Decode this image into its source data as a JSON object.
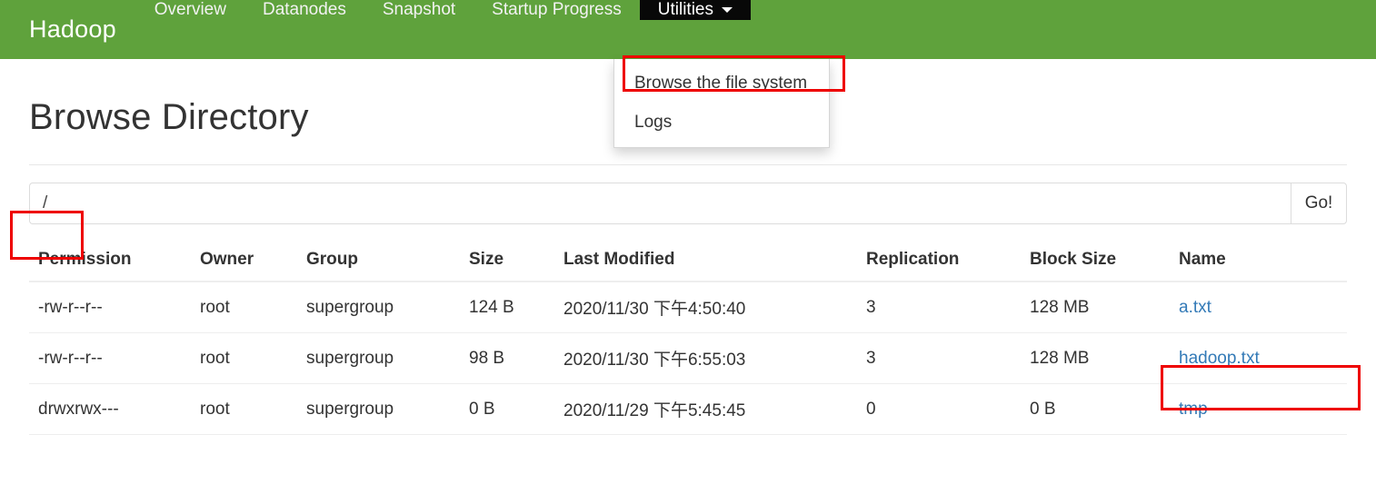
{
  "navbar": {
    "brand": "Hadoop",
    "background_color": "#5FA23C",
    "active_background_color": "#080808",
    "items": [
      {
        "label": "Overview",
        "name": "overview",
        "active": false,
        "caret": false
      },
      {
        "label": "Datanodes",
        "name": "datanodes",
        "active": false,
        "caret": false
      },
      {
        "label": "Snapshot",
        "name": "snapshot",
        "active": false,
        "caret": false
      },
      {
        "label": "Startup Progress",
        "name": "startup-progress",
        "active": false,
        "caret": false
      },
      {
        "label": "Utilities",
        "name": "utilities",
        "active": true,
        "caret": true
      }
    ]
  },
  "dropdown": {
    "open": true,
    "items": [
      {
        "label": "Browse the file system",
        "name": "browse-the-file-system",
        "highlighted": true
      },
      {
        "label": "Logs",
        "name": "logs",
        "highlighted": false
      }
    ]
  },
  "main": {
    "title": "Browse Directory"
  },
  "path_bar": {
    "value": "/",
    "placeholder": "",
    "go_label": "Go!",
    "highlighted": true
  },
  "table": {
    "columns": [
      "Permission",
      "Owner",
      "Group",
      "Size",
      "Last Modified",
      "Replication",
      "Block Size",
      "Name"
    ],
    "rows": [
      {
        "permission": "-rw-r--r--",
        "owner": "root",
        "group": "supergroup",
        "size": "124 B",
        "last_modified": "2020/11/30 下午4:50:40",
        "replication": "3",
        "block_size": "128 MB",
        "name": "a.txt",
        "name_highlighted": false
      },
      {
        "permission": "-rw-r--r--",
        "owner": "root",
        "group": "supergroup",
        "size": "98 B",
        "last_modified": "2020/11/30 下午6:55:03",
        "replication": "3",
        "block_size": "128 MB",
        "name": "hadoop.txt",
        "name_highlighted": true
      },
      {
        "permission": "drwxrwx---",
        "owner": "root",
        "group": "supergroup",
        "size": "0 B",
        "last_modified": "2020/11/29 下午5:45:45",
        "replication": "0",
        "block_size": "0 B",
        "name": "tmp",
        "name_highlighted": false
      }
    ]
  },
  "annotations": {
    "color": "#ee0000",
    "boxes": [
      {
        "name": "redbox-browse-the-file-system"
      },
      {
        "name": "redbox-path-input"
      },
      {
        "name": "redbox-name-hadoop-txt"
      }
    ]
  }
}
